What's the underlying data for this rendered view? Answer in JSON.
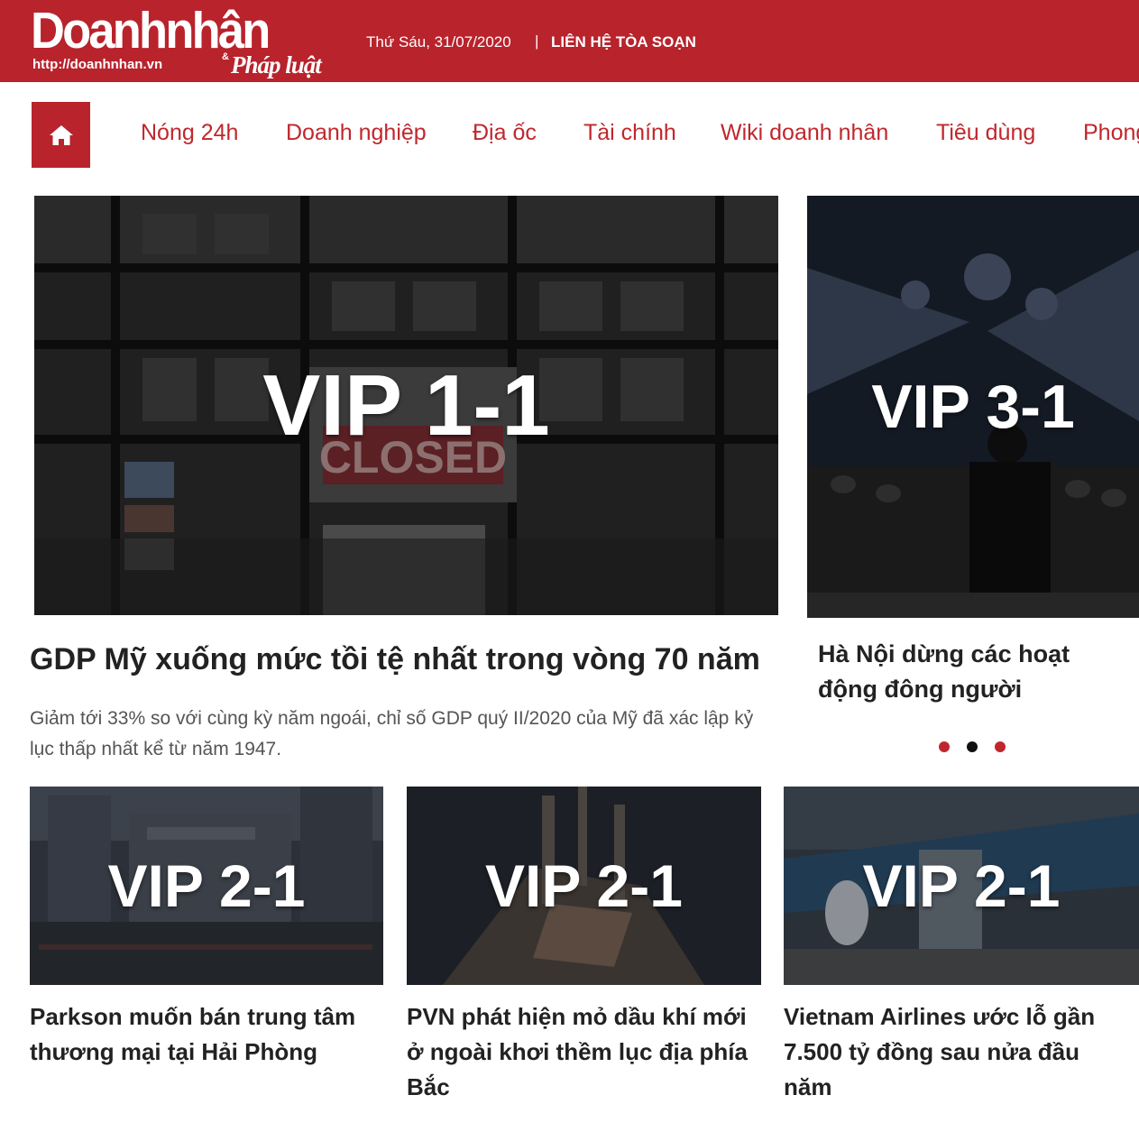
{
  "header": {
    "logo_main": "Doanhnhân",
    "logo_url": "http://doanhnhan.vn",
    "logo_amp": "&",
    "logo_sub": "Pháp luật",
    "date": "Thứ Sáu, 31/07/2020",
    "separator": "|",
    "contact": "LIÊN HỆ TÒA SOẠN",
    "brand_color": "#b8232c"
  },
  "nav": {
    "home_icon": "home-icon",
    "items": [
      "Nóng 24h",
      "Doanh nghiệp",
      "Địa ốc",
      "Tài chính",
      "Wiki doanh nhân",
      "Tiêu dùng",
      "Phong"
    ]
  },
  "featured": {
    "main": {
      "image_label": "VIP 1-1",
      "sign_text": "CLOSED",
      "headline": "GDP Mỹ xuống mức tồi tệ nhất trong vòng 70 năm",
      "summary": "Giảm tới 33% so với cùng kỳ năm ngoái, chỉ số GDP quý II/2020 của Mỹ đã xác lập kỷ lục thấp nhất kể từ năm 1947."
    },
    "side": {
      "image_label": "VIP 3-1",
      "headline": "Hà Nội dừng các hoạt động đông người"
    },
    "dots": [
      "#c0272d",
      "#111111",
      "#c0272d"
    ]
  },
  "articles": [
    {
      "image_label": "VIP 2-1",
      "headline": "Parkson muốn bán trung tâm thương mại tại Hải Phòng"
    },
    {
      "image_label": "VIP 2-1",
      "headline": "PVN phát hiện mỏ dầu khí mới ở ngoài khơi thềm lục địa phía Bắc"
    },
    {
      "image_label": "VIP 2-1",
      "headline": "Vietnam Airlines ước lỗ gần 7.500 tỷ đồng sau nửa đầu năm"
    }
  ]
}
